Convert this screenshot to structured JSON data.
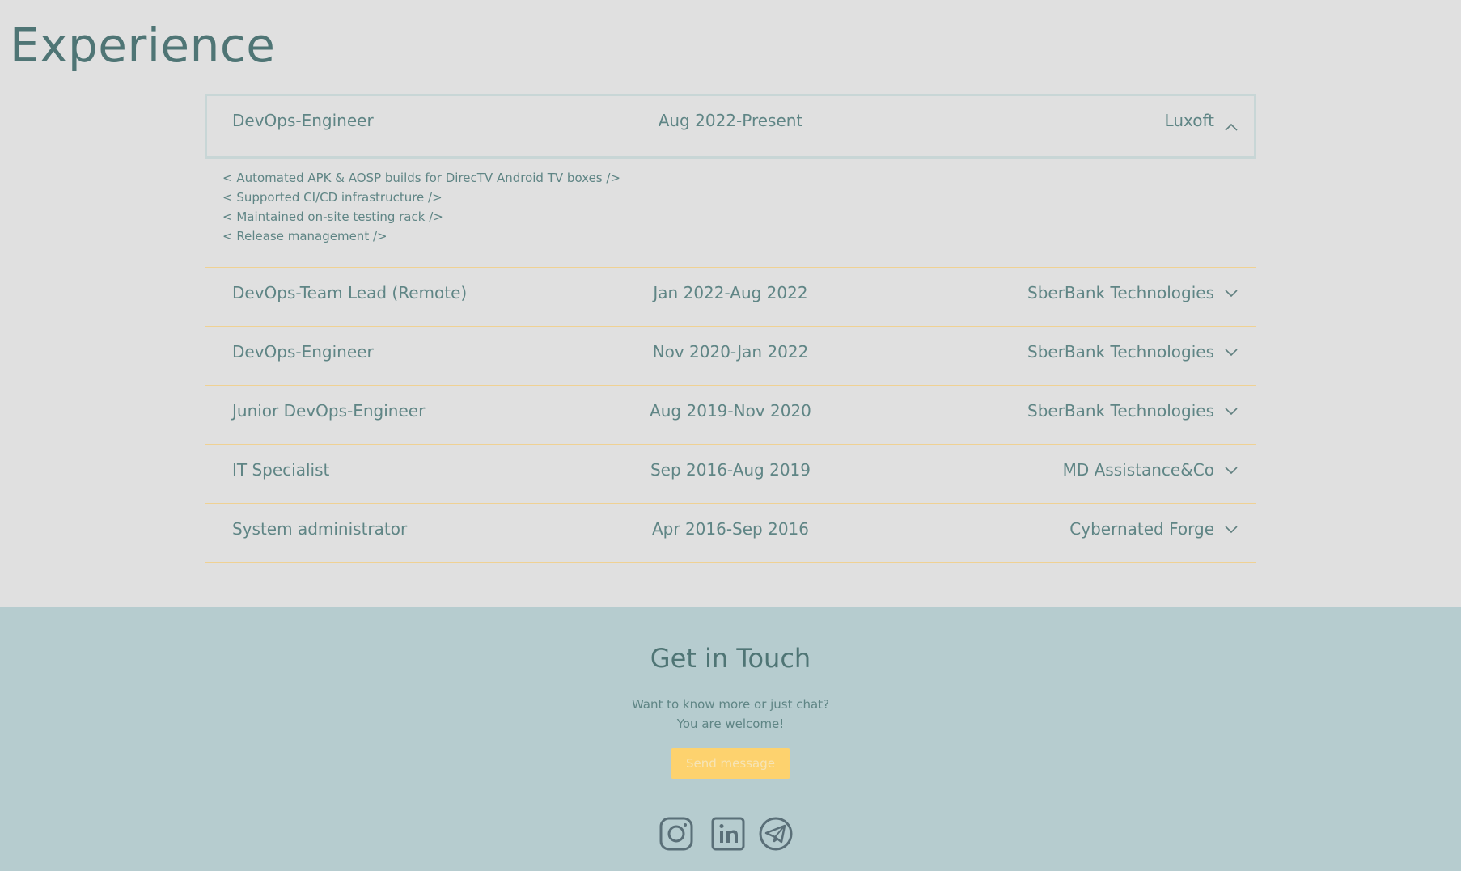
{
  "page_title": "Experience",
  "experience": [
    {
      "role": "DevOps-Engineer",
      "dates": "Aug 2022-Present",
      "company": "Luxoft",
      "expanded": true,
      "details": [
        "< Automated APK & AOSP builds for DirecTV Android TV boxes />",
        "< Supported CI/CD infrastructure />",
        "< Maintained on-site testing rack />",
        "< Release management />"
      ]
    },
    {
      "role": "DevOps-Team Lead (Remote)",
      "dates": "Jan 2022-Aug 2022",
      "company": "SberBank Technologies",
      "expanded": false
    },
    {
      "role": "DevOps-Engineer",
      "dates": "Nov 2020-Jan 2022",
      "company": "SberBank Technologies",
      "expanded": false
    },
    {
      "role": "Junior DevOps-Engineer",
      "dates": "Aug 2019-Nov 2020",
      "company": "SberBank Technologies",
      "expanded": false
    },
    {
      "role": "IT Specialist",
      "dates": "Sep 2016-Aug 2019",
      "company": "MD Assistance&Co",
      "expanded": false
    },
    {
      "role": "System administrator",
      "dates": "Apr 2016-Sep 2016",
      "company": "Cybernated Forge",
      "expanded": false
    }
  ],
  "contact": {
    "title": "Get in Touch",
    "line1": "Want to know more or just chat?",
    "line2": "You are welcome!",
    "button_label": "Send message"
  },
  "socials": [
    {
      "name": "instagram",
      "icon": "instagram-icon"
    },
    {
      "name": "linkedin",
      "icon": "linkedin-icon"
    },
    {
      "name": "telegram",
      "icon": "telegram-icon"
    }
  ],
  "colors": {
    "background": "#e0e0e0",
    "footer_background": "#b6cccf",
    "text": "#5f8585",
    "divider": "#efd193",
    "button": "#fdd26e"
  }
}
